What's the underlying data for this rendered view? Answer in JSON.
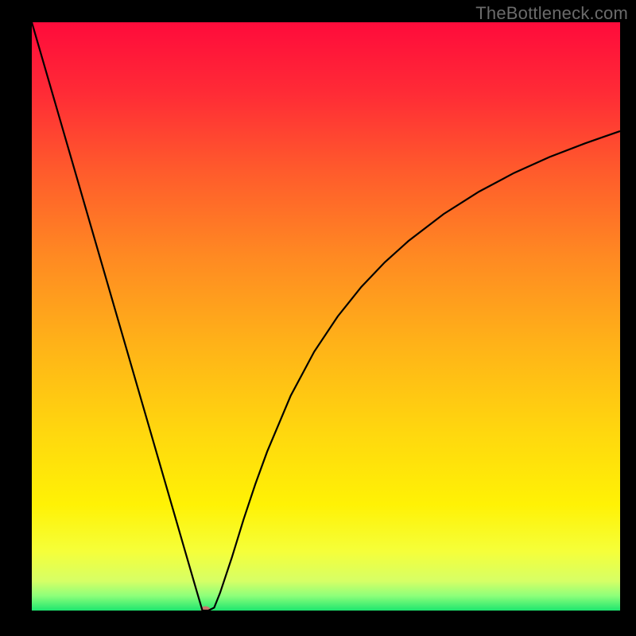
{
  "watermark": "TheBottleneck.com",
  "chart_data": {
    "type": "line",
    "title": "",
    "xlabel": "",
    "ylabel": "",
    "xlim": [
      0,
      100
    ],
    "ylim": [
      0,
      100
    ],
    "grid": false,
    "legend": false,
    "background_gradient": {
      "stops": [
        {
          "offset": 0.0,
          "color": "#ff0b3b"
        },
        {
          "offset": 0.12,
          "color": "#ff2b36"
        },
        {
          "offset": 0.25,
          "color": "#ff5a2c"
        },
        {
          "offset": 0.4,
          "color": "#ff8a22"
        },
        {
          "offset": 0.55,
          "color": "#ffb318"
        },
        {
          "offset": 0.7,
          "color": "#ffd80e"
        },
        {
          "offset": 0.82,
          "color": "#fff205"
        },
        {
          "offset": 0.9,
          "color": "#f5ff3a"
        },
        {
          "offset": 0.95,
          "color": "#d6ff66"
        },
        {
          "offset": 0.975,
          "color": "#8dff7a"
        },
        {
          "offset": 1.0,
          "color": "#1ee66f"
        }
      ]
    },
    "series": [
      {
        "name": "bottleneck-curve",
        "color": "#000000",
        "x": [
          0,
          2,
          4,
          6,
          8,
          10,
          12,
          14,
          16,
          18,
          20,
          22,
          24,
          26,
          28,
          29,
          30,
          31,
          32,
          34,
          36,
          38,
          40,
          44,
          48,
          52,
          56,
          60,
          64,
          70,
          76,
          82,
          88,
          94,
          100
        ],
        "y": [
          100,
          93.1,
          86.2,
          79.3,
          72.4,
          65.5,
          58.6,
          51.7,
          44.8,
          37.9,
          31.0,
          24.1,
          17.2,
          10.3,
          3.4,
          0.0,
          0.0,
          0.5,
          3.0,
          9.0,
          15.5,
          21.5,
          27.0,
          36.5,
          44.0,
          50.0,
          55.0,
          59.2,
          62.8,
          67.4,
          71.2,
          74.4,
          77.1,
          79.4,
          81.5
        ]
      }
    ],
    "marker": {
      "name": "min-point",
      "x": 29.5,
      "y": 0.2,
      "color": "#c9776f",
      "rx": 6,
      "ry": 4
    }
  }
}
